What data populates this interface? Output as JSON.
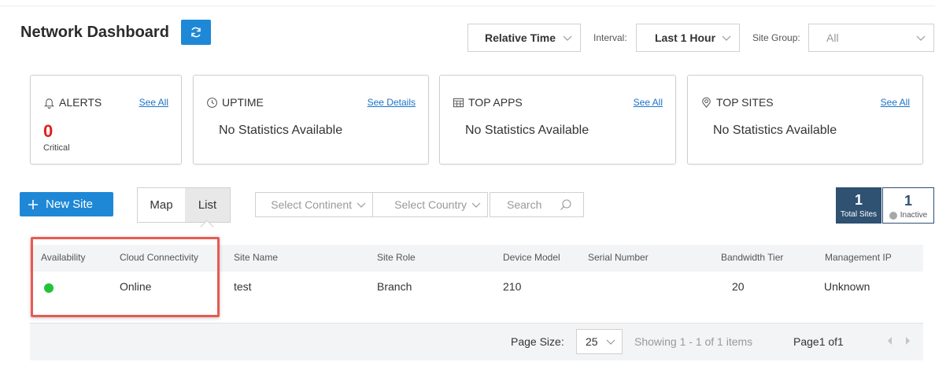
{
  "header": {
    "title": "Network Dashboard",
    "relative_time": "Relative Time",
    "interval_label": "Interval:",
    "interval_value": "Last 1 Hour",
    "site_group_label": "Site Group:",
    "site_group_value": "All"
  },
  "cards": {
    "alerts": {
      "title": "ALERTS",
      "link": "See All",
      "count": "0",
      "count_label": "Critical"
    },
    "uptime": {
      "title": "UPTIME",
      "link": "See Details",
      "empty": "No Statistics Available"
    },
    "top_apps": {
      "title": "TOP APPS",
      "link": "See All",
      "empty": "No Statistics Available"
    },
    "top_sites": {
      "title": "TOP SITES",
      "link": "See All",
      "empty": "No Statistics Available"
    }
  },
  "toolbar": {
    "new_site": "New Site",
    "view_map": "Map",
    "view_list": "List",
    "select_continent": "Select Continent",
    "select_country": "Select Country",
    "search_placeholder": "Search",
    "total_sites_count": "1",
    "total_sites_label": "Total Sites",
    "inactive_count": "1",
    "inactive_label": "Inactive"
  },
  "table": {
    "columns": [
      "Availability",
      "Cloud Connectivity",
      "Site Name",
      "Site Role",
      "Device Model",
      "Serial Number",
      "Bandwidth Tier",
      "Management IP"
    ],
    "rows": [
      {
        "availability": "online",
        "cloud_connectivity": "Online",
        "site_name": "test",
        "site_role": "Branch",
        "device_model": "210",
        "serial_number": "",
        "bandwidth_tier": "20",
        "management_ip": "Unknown"
      }
    ]
  },
  "pager": {
    "page_size_label": "Page Size:",
    "page_size": "25",
    "showing": "Showing 1 - 1 of 1 items",
    "page": "Page1 of1"
  },
  "colors": {
    "accent": "#1e88d6",
    "critical": "#e0201c",
    "online": "#22c33b",
    "highlight": "#e85a52",
    "stat_dark": "#2f5172"
  }
}
